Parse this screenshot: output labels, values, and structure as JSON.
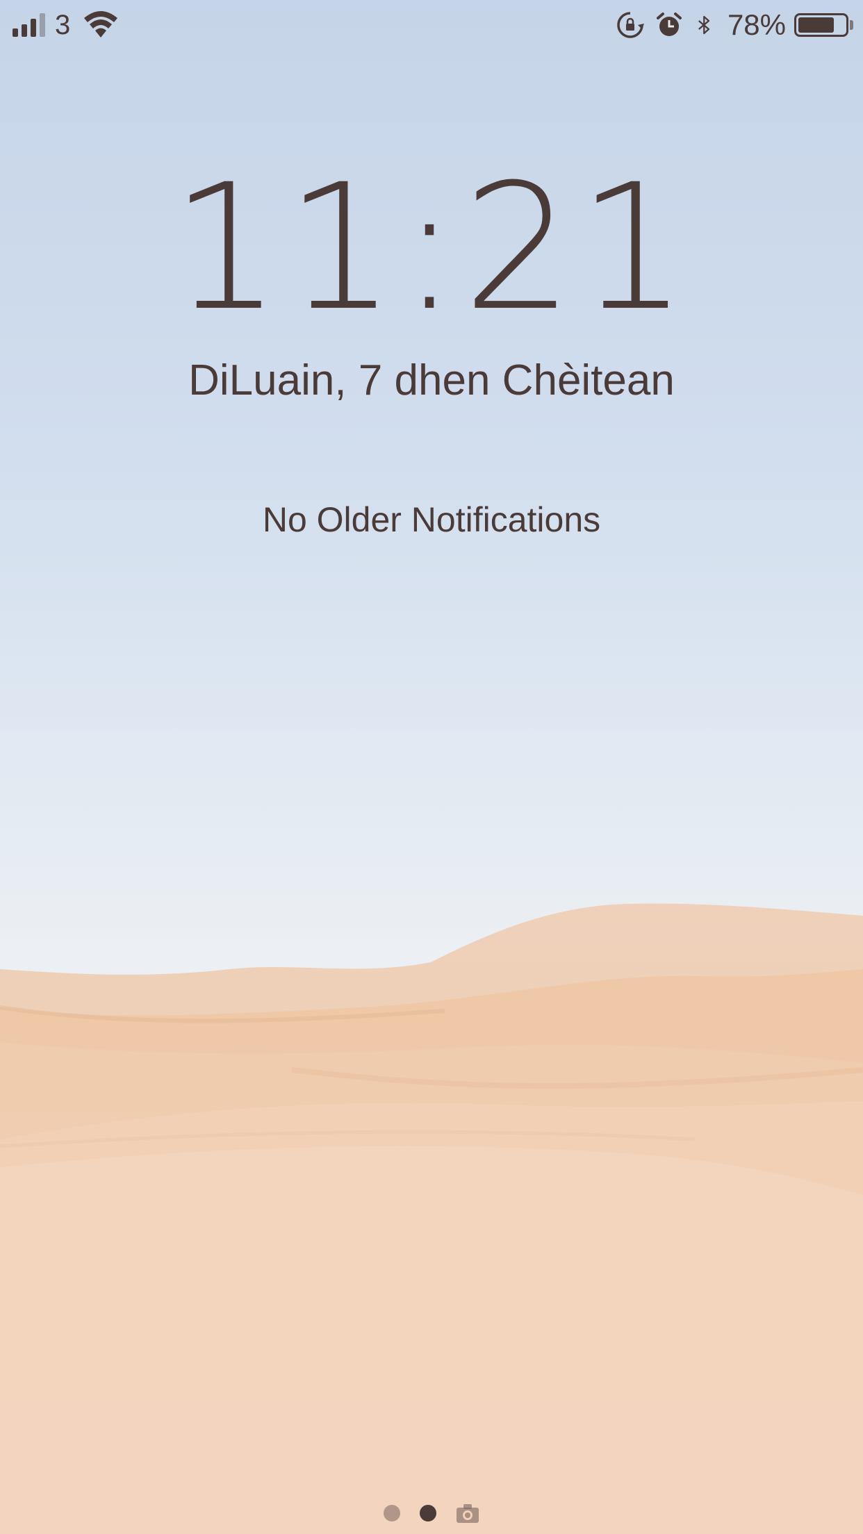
{
  "status_bar": {
    "signal_bars": 4,
    "signal_bars_filled": 3,
    "carrier": "3",
    "wifi_icon": "wifi-icon",
    "orientation_lock_icon": "rotation-lock-icon",
    "alarm_icon": "alarm-clock-icon",
    "bluetooth_icon": "bluetooth-icon",
    "battery_percent_text": "78%",
    "battery_level": 0.78
  },
  "lock_screen": {
    "time": "11:21",
    "date": "DiLuain, 7 dhen Chèitean",
    "notifications_text": "No Older Notifications"
  },
  "page_indicator": {
    "pages": 3,
    "active_index": 1,
    "last_icon": "camera-icon"
  },
  "colors": {
    "text": "#4a3a38",
    "sky_top": "#c5d4e8",
    "sky_bottom": "#eceff3",
    "sand": "#f0cfb3"
  }
}
